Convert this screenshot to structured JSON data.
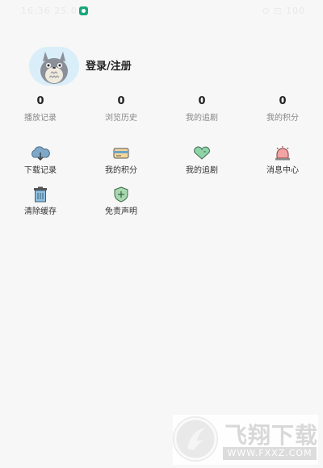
{
  "status_bar": {
    "left_text": "16:36 25.0 ∮",
    "right_text": "⊙ ⊡ 100"
  },
  "profile": {
    "login_label": "登录/注册"
  },
  "stats": [
    {
      "value": "0",
      "label": "播放记录"
    },
    {
      "value": "0",
      "label": "浏览历史"
    },
    {
      "value": "0",
      "label": "我的追剧"
    },
    {
      "value": "0",
      "label": "我的积分"
    }
  ],
  "menu": [
    {
      "label": "下载记录",
      "icon": "cloud-download-icon"
    },
    {
      "label": "我的积分",
      "icon": "card-icon"
    },
    {
      "label": "我的追剧",
      "icon": "heart-icon"
    },
    {
      "label": "消息中心",
      "icon": "alarm-bell-icon"
    },
    {
      "label": "清除缓存",
      "icon": "trash-icon"
    },
    {
      "label": "免责声明",
      "icon": "shield-icon"
    }
  ],
  "watermark": {
    "title": "飞翔下载",
    "url": "WWW.FXXZ.COM"
  }
}
